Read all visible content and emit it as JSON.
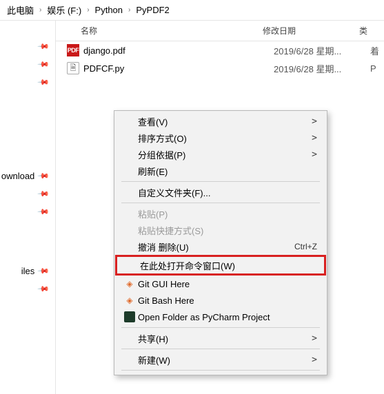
{
  "breadcrumb": {
    "items": [
      "此电脑",
      "娱乐 (F:)",
      "Python",
      "PyPDF2"
    ]
  },
  "sidebar": {
    "items": [
      {
        "label": ""
      },
      {
        "label": ""
      },
      {
        "label": ""
      },
      {
        "label": "ownload"
      },
      {
        "label": ""
      },
      {
        "label": ""
      },
      {
        "label": "iles"
      },
      {
        "label": ""
      }
    ]
  },
  "columns": {
    "name": "名称",
    "date": "修改日期",
    "type": "类"
  },
  "files": [
    {
      "name": "django.pdf",
      "date": "2019/6/28 星期...",
      "type": "着",
      "icon": "PDF"
    },
    {
      "name": "PDFCF.py",
      "date": "2019/6/28 星期...",
      "type": "P",
      "icon": "▫"
    }
  ],
  "menu": {
    "view": "查看(V)",
    "sort": "排序方式(O)",
    "group": "分组依据(P)",
    "refresh": "刷新(E)",
    "customize": "自定义文件夹(F)...",
    "paste": "粘贴(P)",
    "paste_shortcut": "粘贴快捷方式(S)",
    "undo": "撤消 删除(U)",
    "undo_key": "Ctrl+Z",
    "open_cmd": "在此处打开命令窗口(W)",
    "git_gui": "Git GUI Here",
    "git_bash": "Git Bash Here",
    "pycharm": "Open Folder as PyCharm Project",
    "share": "共享(H)",
    "new": "新建(W)"
  }
}
